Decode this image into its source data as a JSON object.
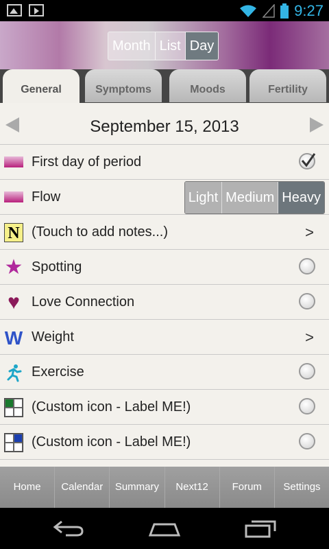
{
  "status_bar": {
    "time": "9:27"
  },
  "view_switch": {
    "options": [
      "Month",
      "List",
      "Day"
    ],
    "selected": "Day"
  },
  "tabs": [
    {
      "label": "General",
      "active": true
    },
    {
      "label": "Symptoms",
      "active": false
    },
    {
      "label": "Moods",
      "active": false
    },
    {
      "label": "Fertility",
      "active": false
    }
  ],
  "date": "September 15, 2013",
  "rows": [
    {
      "label": "First day of period",
      "icon": "period-bar-icon",
      "control": "checkbox-checked"
    },
    {
      "label": "Flow",
      "icon": "period-bar-icon",
      "control": "segmented",
      "options": [
        "Light",
        "Medium",
        "Heavy"
      ],
      "selected": "Heavy"
    },
    {
      "label": "(Touch to add notes...)",
      "icon": "notes-icon",
      "icon_text": "N",
      "control": "chevron",
      "chevron": ">"
    },
    {
      "label": "Spotting",
      "icon": "star-icon",
      "control": "radio"
    },
    {
      "label": "Love Connection",
      "icon": "heart-icon",
      "control": "radio"
    },
    {
      "label": "Weight",
      "icon": "weight-icon",
      "icon_text": "W",
      "control": "chevron",
      "chevron": ">"
    },
    {
      "label": "Exercise",
      "icon": "runner-icon",
      "control": "radio"
    },
    {
      "label": "(Custom icon - Label ME!)",
      "icon": "custom-grid-green-icon",
      "control": "radio"
    },
    {
      "label": "(Custom icon - Label ME!)",
      "icon": "custom-grid-blue-icon",
      "control": "radio"
    }
  ],
  "bottom_nav": [
    "Home",
    "Calendar",
    "Summary",
    "Next12",
    "Forum",
    "Settings"
  ],
  "colors": {
    "accent_clock": "#33b5e5",
    "period": "#b8207c",
    "spotting": "#b0299c",
    "love": "#8b1a5a",
    "weight": "#2f53c8",
    "exercise": "#1ea6c8"
  }
}
